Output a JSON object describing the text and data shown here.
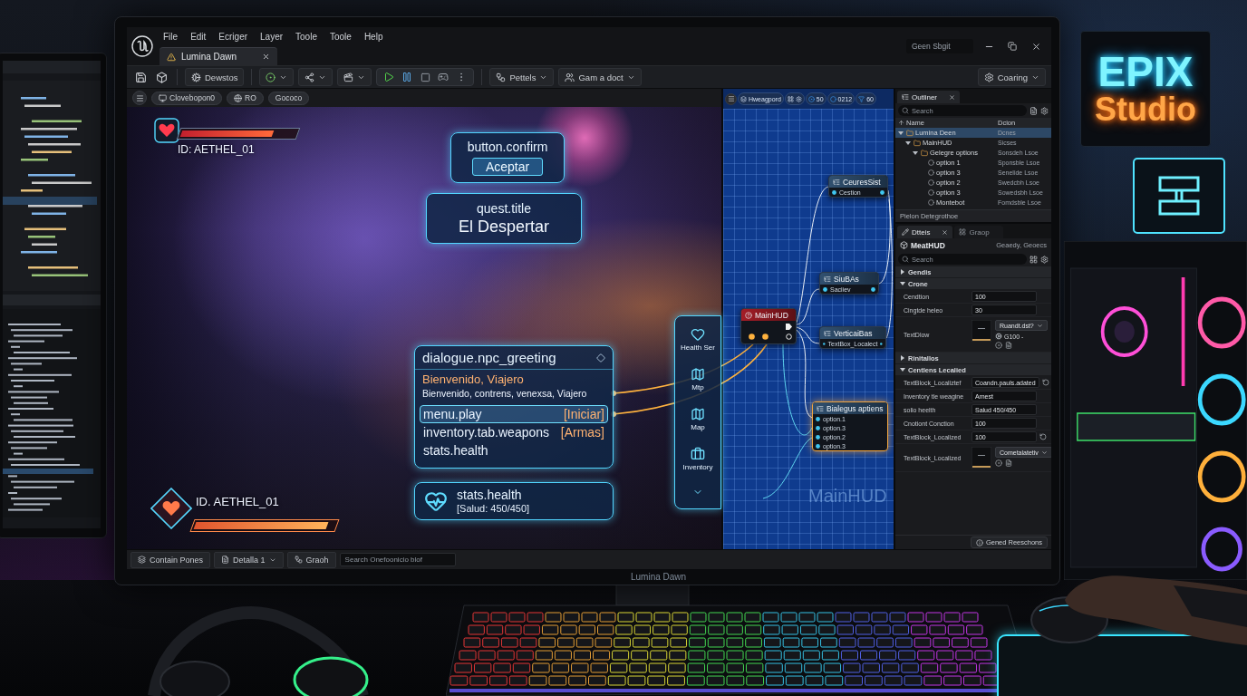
{
  "sign": {
    "line_1": "EPIX",
    "line_2": "Studio"
  },
  "editor": {
    "menu": [
      "File",
      "Edit",
      "Ecriger",
      "Layer",
      "Toole",
      "Toole",
      "Help"
    ],
    "title_search": {
      "placeholder": "Geen Sbgit"
    },
    "document_tab": {
      "label": "Lumina Dawn",
      "selected": true
    },
    "toolbar": {
      "button": "Dewstos",
      "menus": [
        "Pettels",
        "Gam a doct"
      ],
      "settings": "Coaring"
    },
    "viewport": {
      "chips": [
        "Clovebopon0",
        "RO",
        "Gococo"
      ],
      "player_hud": {
        "id": "ID: AETHEL_01",
        "level": 0.8
      },
      "confirm_card": {
        "key": "button.confirm",
        "button": "Aceptar"
      },
      "quest_card": {
        "key": "quest.title",
        "value": "El Despertar"
      },
      "dialogue": {
        "key": "dialogue.npc_greeting",
        "title": "Bienvenido, Viajero",
        "text": "Bienvenido, contrens, venexsa, Viajero",
        "entries": [
          {
            "key": "menu.play",
            "value": "[Iniciar]",
            "selected": true
          },
          {
            "key": "inventory.tab.weapons",
            "value": "[Armas]",
            "selected": false
          },
          {
            "key": "stats.health",
            "selected": false
          }
        ]
      },
      "health_card": {
        "key": "stats.health",
        "value": "[Salud: 450/450]"
      },
      "player_badge": {
        "id": "ID. AETHEL_01",
        "level": 0.95
      },
      "side_menu": [
        {
          "label": "Health Ser"
        },
        {
          "label": "Mtp"
        },
        {
          "label": "Map"
        },
        {
          "label": "Inventory"
        }
      ]
    },
    "graph": {
      "chips": [
        "Hweagpord",
        "50",
        "0212",
        "60"
      ],
      "nodes": [
        {
          "kind": "widget",
          "title": "CeuresSist",
          "pins": [
            "Cestion"
          ],
          "selected": false
        },
        {
          "kind": "widget",
          "title": "SiuBAs",
          "pins": [
            "Saciiev"
          ],
          "selected": false
        },
        {
          "kind": "root",
          "title": "MainHUD",
          "selected": false
        },
        {
          "kind": "widget",
          "title": "VerticaiBas",
          "pins": [
            "TextBox_Localect"
          ],
          "selected": false
        },
        {
          "kind": "widget",
          "title": "Bialegus aptiens",
          "pins": [
            "option.1",
            "option.3",
            "option.2",
            "option.3"
          ],
          "selected": true
        }
      ],
      "label": "MainHUD"
    },
    "outliner": {
      "tab": "Outliner",
      "search": {
        "placeholder": "Search"
      },
      "columns": [
        "Name",
        "Dcion"
      ],
      "rows": [
        {
          "name": "Lumina Deen",
          "type": "Dcnes",
          "selected": true,
          "expanded": true,
          "children": [
            {
              "name": "MainHUD",
              "type": "Sicses",
              "selected": false,
              "expanded": true,
              "children": [
                {
                  "name": "Gelegre options",
                  "type": "Sonsdeh Lsoe",
                  "selected": false,
                  "expanded": true,
                  "children": [
                    {
                      "name": "option 1",
                      "type": "Sponsble Lsoe",
                      "selected": false
                    },
                    {
                      "name": "option 3",
                      "type": "Senelide Lsoe",
                      "selected": false
                    },
                    {
                      "name": "option 2",
                      "type": "Swedcbh Lsoe",
                      "selected": false
                    },
                    {
                      "name": "option 3",
                      "type": "Sowedsbh Lsoe",
                      "selected": false
                    },
                    {
                      "name": "Montebot",
                      "type": "Fomdsble Lsoe",
                      "selected": false
                    }
                  ]
                }
              ]
            }
          ]
        }
      ],
      "footer": "Pielon Detegrothoe"
    },
    "details": {
      "tabs": [
        {
          "label": "Dtteis",
          "selected": true
        },
        {
          "label": "Graop",
          "selected": false
        }
      ],
      "title": "MeatHUD",
      "subtitle": "Geaedy, Geoecs",
      "search": {
        "placeholder": "Search"
      },
      "rows": [
        {
          "kind": "section",
          "label": "Gendis",
          "expanded": false
        },
        {
          "kind": "section",
          "label": "Crone",
          "expanded": true
        },
        {
          "kind": "text",
          "label": "Cendtion",
          "value": "100",
          "reset": false
        },
        {
          "kind": "text",
          "label": "Cingtde heleo",
          "value": "30",
          "reset": false
        },
        {
          "kind": "swatch",
          "label": "TextDlow",
          "option": "Ruandt.dst?",
          "value": "G100 -"
        },
        {
          "kind": "section",
          "label": "Rinitallos",
          "expanded": false
        },
        {
          "kind": "section",
          "label": "Centlens Lecalied",
          "expanded": true
        },
        {
          "kind": "text",
          "label": "TextBlock_Localiztef",
          "value": "Coandn.pauls.adated",
          "reset": true
        },
        {
          "kind": "text",
          "label": "Inventory tle weagine",
          "value": "Amest",
          "reset": false
        },
        {
          "kind": "text",
          "label": "solio heelth",
          "value": "Salud 450/450",
          "reset": false
        },
        {
          "kind": "text",
          "label": "Cnotiont Conction",
          "value": "100",
          "reset": false
        },
        {
          "kind": "text",
          "label": "TextBlock_Localized",
          "value": "100",
          "reset": true
        },
        {
          "kind": "swatch",
          "label": "TextBlock_Localized",
          "option": "Cometalatetiv"
        }
      ],
      "footer": "Gened Reeschons"
    },
    "bottom_bar": {
      "items": [
        {
          "label": "Contain Pones",
          "dropdown": false
        },
        {
          "label": "Detalla 1",
          "dropdown": true
        },
        {
          "label": "Graoh",
          "dropdown": false
        }
      ],
      "search": {
        "placeholder": "Search Onefoonicio blof"
      }
    }
  },
  "monitor_label": "Lumina Dawn"
}
